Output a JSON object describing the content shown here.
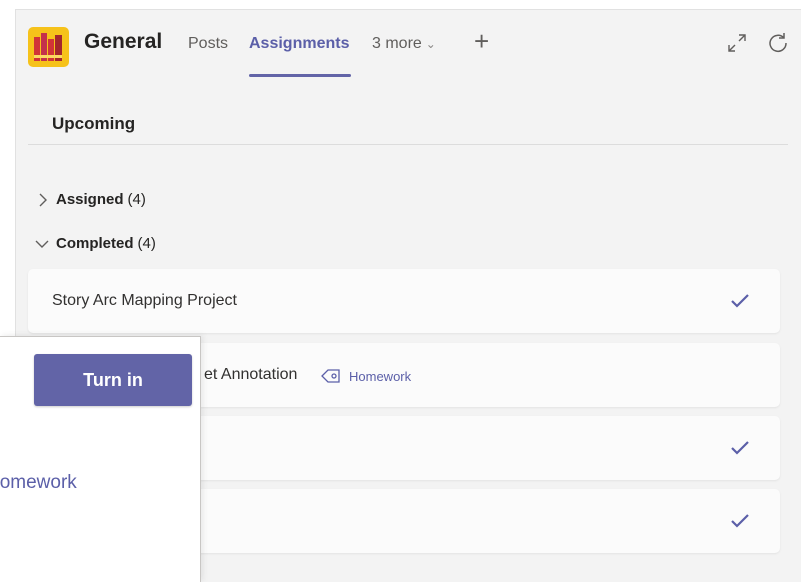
{
  "header": {
    "channel_title": "General",
    "tabs": [
      {
        "label": "Posts"
      },
      {
        "label": "Assignments"
      },
      {
        "label": "3 more"
      }
    ],
    "add_tab_label": "+",
    "accent_color": "#6264a7"
  },
  "section": {
    "title": "Upcoming"
  },
  "groups": [
    {
      "name": "Assigned",
      "count": "(4)",
      "expanded": false
    },
    {
      "name": "Completed",
      "count": "(4)",
      "expanded": true
    }
  ],
  "assignments": [
    {
      "title": "Story Arc Mapping Project",
      "completed": true,
      "icon": "check-icon"
    },
    {
      "title": "et Annotation",
      "tag": "Homework",
      "tag_icon": "tag-icon"
    },
    {
      "title": "",
      "completed": true,
      "icon": "check-icon"
    },
    {
      "title": "",
      "completed": true,
      "icon": "check-icon"
    }
  ],
  "popup": {
    "button_label": "Turn in",
    "tag_text": "Homework"
  }
}
